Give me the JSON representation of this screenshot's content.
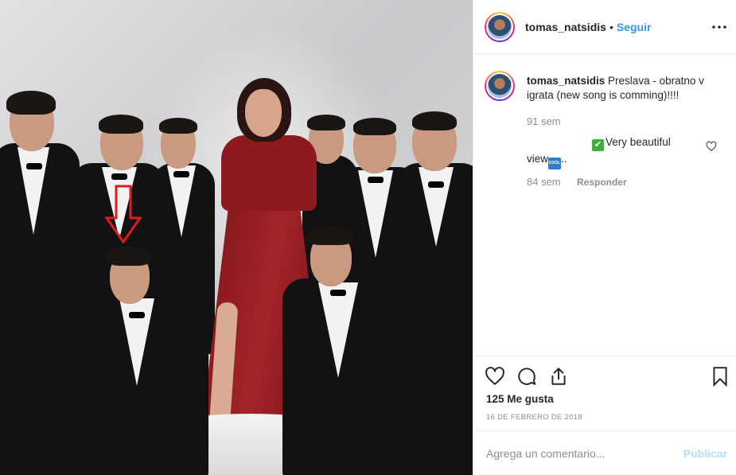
{
  "post": {
    "username": "tomas_natsidis",
    "separator": "•",
    "follow_label": "Seguir"
  },
  "caption": {
    "username": "tomas_natsidis",
    "text": " Preslava - obratno v igrata (new song is comming)!!!!",
    "time": "91 sem"
  },
  "comment": {
    "text_line1": "Very beautiful",
    "text_line2": "view",
    "text_suffix": "..",
    "check_emoji": "✔",
    "cool_emoji": "COOL",
    "time": "84 sem",
    "reply_label": "Responder"
  },
  "stats": {
    "likes": "125 Me gusta",
    "date": "16 DE FEBRERO DE 2018"
  },
  "comment_box": {
    "placeholder": "Agrega un comentario...",
    "publish_label": "Publicar"
  },
  "colors": {
    "link_blue": "#3897f0",
    "publish_disabled": "#b2dffc",
    "annotation_arrow": "#e01b1b"
  },
  "icons": [
    "more-options-icon",
    "like-heart-icon",
    "comment-icon",
    "share-icon",
    "bookmark-icon",
    "comment-like-heart-icon",
    "annotation-arrow-icon"
  ]
}
